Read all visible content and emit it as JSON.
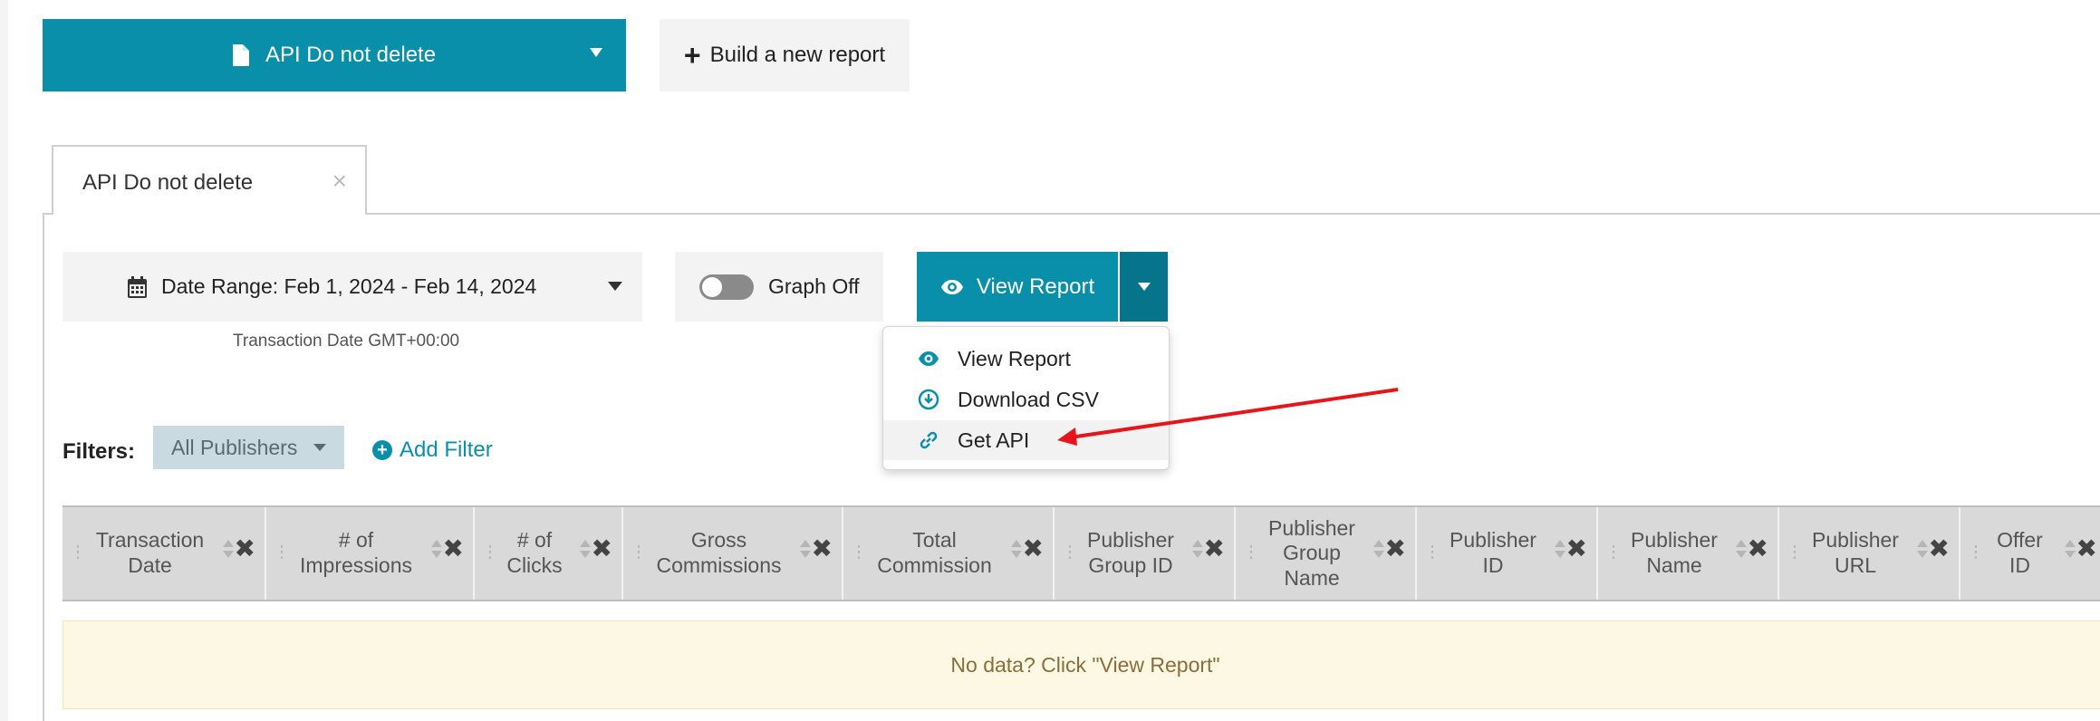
{
  "top": {
    "report_select_label": "API Do not delete",
    "build_report_label": "Build a new report"
  },
  "tab": {
    "label": "API Do not delete",
    "close_glyph": "×"
  },
  "controls": {
    "date_range_label": "Date Range: Feb 1, 2024 - Feb 14, 2024",
    "date_note": "Transaction Date GMT+00:00",
    "graph_toggle_label": "Graph Off",
    "graph_on": false,
    "view_report_label": "View Report"
  },
  "dropdown": {
    "items": [
      {
        "label": "View Report",
        "icon": "eye-icon"
      },
      {
        "label": "Download CSV",
        "icon": "download-circle-icon"
      },
      {
        "label": "Get API",
        "icon": "link-icon",
        "highlighted": true
      }
    ]
  },
  "filters": {
    "label": "Filters:",
    "publishers_pill": "All Publishers",
    "add_filter_label": "Add Filter"
  },
  "table": {
    "columns": [
      "Transaction\nDate",
      "# of\nImpressions",
      "# of\nClicks",
      "Gross\nCommissions",
      "Total\nCommission",
      "Publisher\nGroup ID",
      "Publisher\nGroup\nName",
      "Publisher\nID",
      "Publisher\nName",
      "Publisher\nURL",
      "Offer\nID"
    ],
    "empty_message": "No data? Click \"View Report\""
  },
  "colors": {
    "primary": "#0a8fab",
    "primary_dark": "#06748b",
    "annotation_arrow": "#e8141a",
    "empty_bg": "#fcf8e3",
    "empty_text": "#8a6d3b"
  }
}
